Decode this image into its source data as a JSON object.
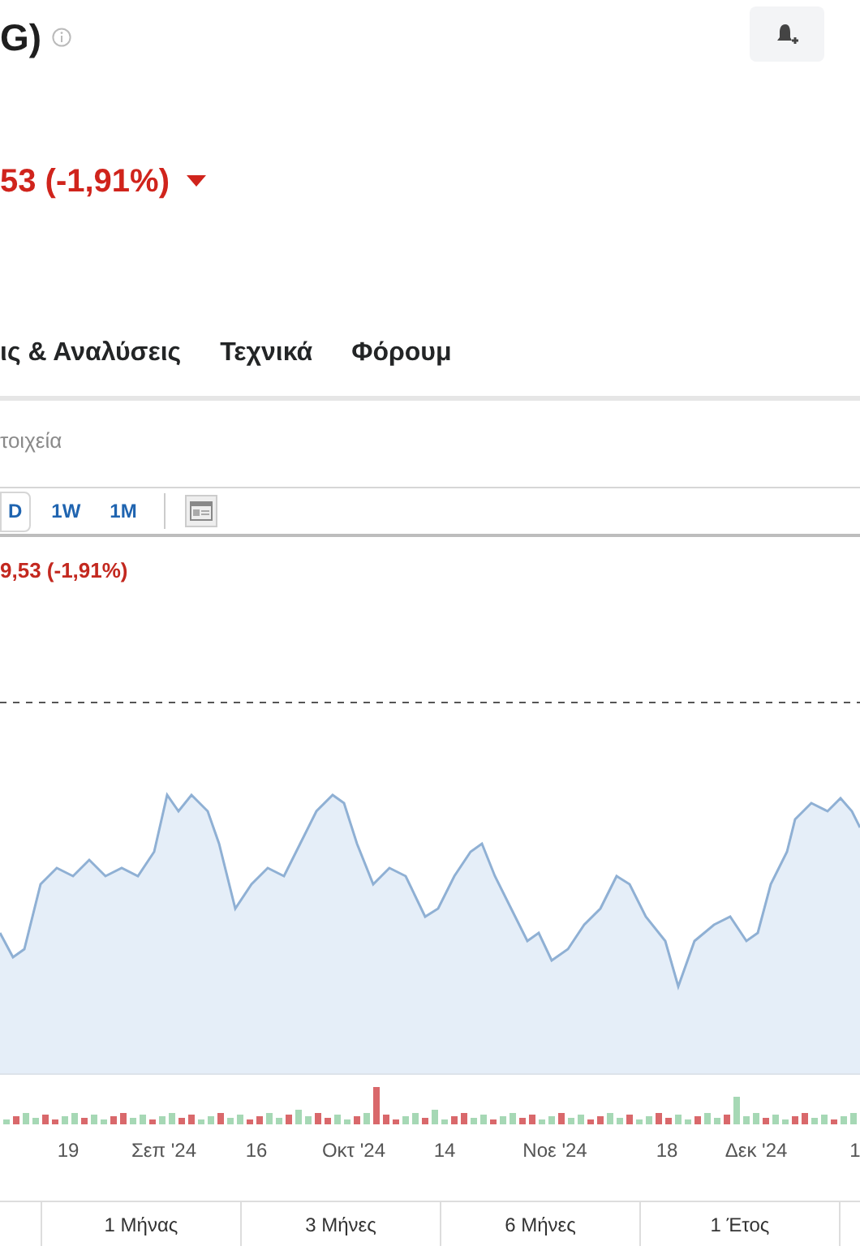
{
  "header": {
    "title": "G)",
    "change": "53 (-1,91%)",
    "falling": true
  },
  "tabs": [
    {
      "label": "ις & Αναλύσεις",
      "selected": false
    },
    {
      "label": "Τεχνικά",
      "selected": false
    },
    {
      "label": "Φόρουμ",
      "selected": false
    }
  ],
  "sub_link": "τοιχεία",
  "intervals": [
    {
      "label": "D",
      "selected": true
    },
    {
      "label": "1W",
      "selected": false
    },
    {
      "label": "1M",
      "selected": false
    }
  ],
  "chart": {
    "change": "9,53 (-1,91%)",
    "x_labels": [
      "19",
      "Σεπ '24",
      "16",
      "Οκτ '24",
      "14",
      "Νοε '24",
      "18",
      "Δεκ '24",
      "1"
    ]
  },
  "ranges": [
    {
      "label": "1 Μήνας",
      "selected": false
    },
    {
      "label": "3 Μήνες",
      "selected": false
    },
    {
      "label": "6 Μήνες",
      "selected": false
    },
    {
      "label": "1 Έτος",
      "selected": false
    }
  ]
}
